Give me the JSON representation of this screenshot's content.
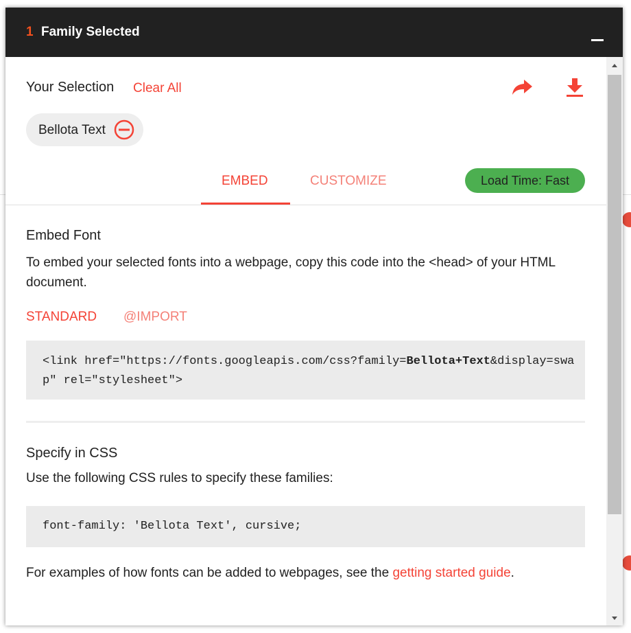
{
  "header": {
    "count": "1",
    "title": "Family Selected"
  },
  "selection": {
    "label": "Your Selection",
    "clear_all": "Clear All",
    "share_icon": "share-arrow-icon",
    "download_icon": "download-icon"
  },
  "chip": {
    "label": "Bellota Text",
    "remove_icon": "minus-circle-icon"
  },
  "tabs": [
    {
      "label": "EMBED",
      "active": true
    },
    {
      "label": "CUSTOMIZE",
      "active": false
    }
  ],
  "load_time": "Load Time: Fast",
  "embed": {
    "heading": "Embed Font",
    "description": "To embed your selected fonts into a webpage, copy this code into the <head> of your HTML document.",
    "subtabs": [
      "STANDARD",
      "@IMPORT"
    ],
    "code_prefix": "<link href=\"https://fonts.googleapis.com/css?family=",
    "code_family": "Bellota+Text",
    "code_suffix": "&display=swap\" rel=\"stylesheet\">"
  },
  "css": {
    "heading": "Specify in CSS",
    "description": "Use the following CSS rules to specify these families:",
    "code": "font-family: 'Bellota Text', cursive;"
  },
  "footer": {
    "text": "For examples of how fonts can be added to webpages, see the ",
    "link": "getting started guide",
    "end": "."
  },
  "colors": {
    "accent": "#f44336",
    "accent_light": "#f48178",
    "header_bg": "#212121",
    "load_time_bg": "#4caf50",
    "code_bg": "#ebebeb"
  }
}
